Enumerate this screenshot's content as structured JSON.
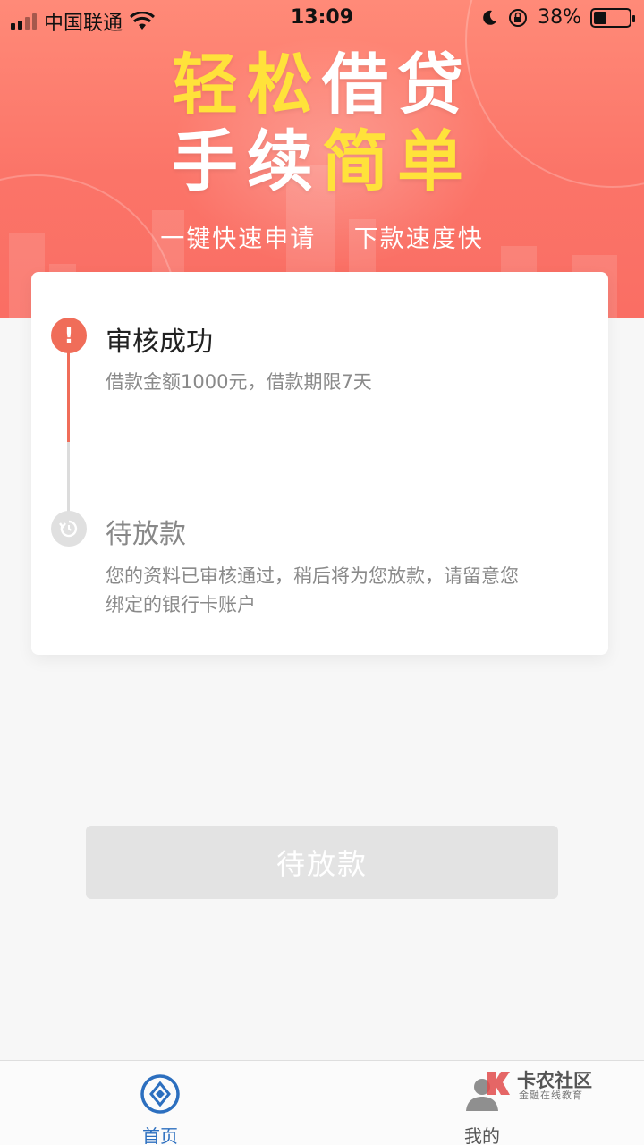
{
  "status_bar": {
    "carrier": "中国联通",
    "time": "13:09",
    "battery_percent": "38%",
    "battery_level": 0.38,
    "icons": [
      "signal-icon",
      "wifi-icon",
      "moon-icon",
      "rotation-lock-icon",
      "battery-icon"
    ]
  },
  "banner": {
    "line1_a": "轻松",
    "line1_b": "借贷",
    "line2_a": "手续",
    "line2_b": "简单",
    "sub_left": "一键快速申请",
    "sub_right": "下款速度快",
    "colors": {
      "top": "#ff8a78",
      "bottom": "#fa6e64",
      "highlight": "#ffe23a"
    }
  },
  "steps": [
    {
      "title": "审核成功",
      "desc": "借款金额1000元，借款期限7天",
      "icon": "exclamation-icon",
      "state": "done",
      "color": "#f06d59"
    },
    {
      "title": "待放款",
      "desc": "您的资料已审核通过，稍后将为您放款，请留意您绑定的银行卡账户",
      "icon": "pending-refresh-icon",
      "state": "pending"
    }
  ],
  "action_button": {
    "label": "待放款",
    "enabled": false
  },
  "tabbar": {
    "items": [
      {
        "label": "首页",
        "icon": "home-diamond-icon",
        "active": true,
        "color": "#2c6fbf"
      },
      {
        "label": "我的",
        "icon": "user-icon",
        "active": false
      }
    ]
  },
  "watermark": {
    "title": "卡农社区",
    "subtitle": "金融在线教育"
  }
}
